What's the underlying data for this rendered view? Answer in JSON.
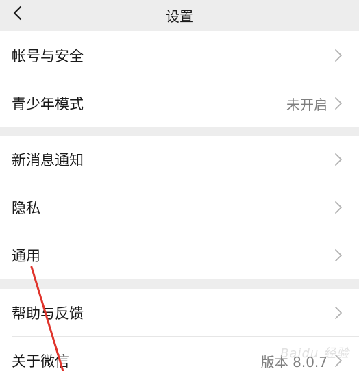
{
  "header": {
    "title": "设置",
    "back_icon": "chevron-left-icon"
  },
  "groups": [
    {
      "rows": [
        {
          "label": "帐号与安全",
          "value": ""
        },
        {
          "label": "青少年模式",
          "value": "未开启"
        }
      ]
    },
    {
      "rows": [
        {
          "label": "新消息通知",
          "value": ""
        },
        {
          "label": "隐私",
          "value": ""
        },
        {
          "label": "通用",
          "value": ""
        }
      ]
    },
    {
      "rows": [
        {
          "label": "帮助与反馈",
          "value": ""
        },
        {
          "label": "关于微信",
          "value": "版本 8.0.7"
        }
      ]
    }
  ],
  "colors": {
    "background": "#ededed",
    "row_bg": "#ffffff",
    "value_text": "#7f7f7f",
    "chevron": "#b2b2b2",
    "annotation_arrow": "#e0342c"
  },
  "watermark": "Baidu 经验"
}
